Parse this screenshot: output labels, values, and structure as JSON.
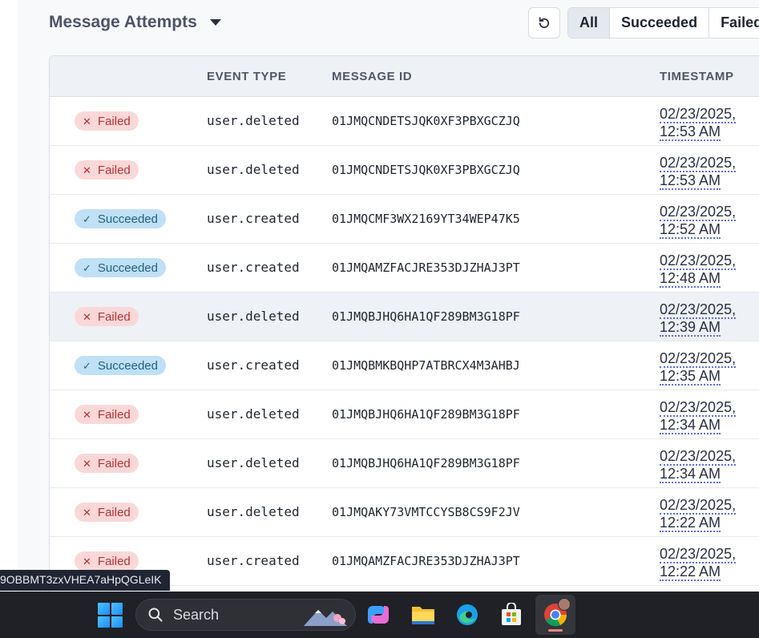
{
  "header": {
    "title": "Message Attempts",
    "filters": [
      "All",
      "Succeeded",
      "Failed"
    ],
    "active_filter": "All"
  },
  "table": {
    "columns": [
      "EVENT TYPE",
      "MESSAGE ID",
      "TIMESTAMP"
    ],
    "rows": [
      {
        "status": "Failed",
        "event": "user.deleted",
        "message_id": "01JMQCNDETSJQK0XF3PBXGCZJQ",
        "date": "02/23/2025,",
        "time": "12:53 AM"
      },
      {
        "status": "Failed",
        "event": "user.deleted",
        "message_id": "01JMQCNDETSJQK0XF3PBXGCZJQ",
        "date": "02/23/2025,",
        "time": "12:53 AM"
      },
      {
        "status": "Succeeded",
        "event": "user.created",
        "message_id": "01JMQCMF3WX2169YT34WEP47K5",
        "date": "02/23/2025,",
        "time": "12:52 AM"
      },
      {
        "status": "Succeeded",
        "event": "user.created",
        "message_id": "01JMQAMZFACJRE353DJZHAJ3PT",
        "date": "02/23/2025,",
        "time": "12:48 AM"
      },
      {
        "status": "Failed",
        "event": "user.deleted",
        "message_id": "01JMQBJHQ6HA1QF289BM3G18PF",
        "date": "02/23/2025,",
        "time": "12:39 AM"
      },
      {
        "status": "Succeeded",
        "event": "user.created",
        "message_id": "01JMQBMKBQHP7ATBRCX4M3AHBJ",
        "date": "02/23/2025,",
        "time": "12:35 AM"
      },
      {
        "status": "Failed",
        "event": "user.deleted",
        "message_id": "01JMQBJHQ6HA1QF289BM3G18PF",
        "date": "02/23/2025,",
        "time": "12:34 AM"
      },
      {
        "status": "Failed",
        "event": "user.deleted",
        "message_id": "01JMQBJHQ6HA1QF289BM3G18PF",
        "date": "02/23/2025,",
        "time": "12:34 AM"
      },
      {
        "status": "Failed",
        "event": "user.deleted",
        "message_id": "01JMQAKY73VMTCCYSB8CS9F2JV",
        "date": "02/23/2025,",
        "time": "12:22 AM"
      },
      {
        "status": "Failed",
        "event": "user.created",
        "message_id": "01JMQAMZFACJRE353DJZHAJ3PT",
        "date": "02/23/2025,",
        "time": "12:22 AM"
      }
    ]
  },
  "tooltip": {
    "text": "9OBBMT3zxVHEA7aHpQGLeIK"
  },
  "taskbar": {
    "search_label": "Search",
    "apps": [
      "copilot-icon",
      "file-explorer-icon",
      "edge-icon",
      "microsoft-store-icon",
      "chrome-icon"
    ]
  },
  "colors": {
    "failed_bg": "#fbd8d8",
    "failed_text": "#b83232",
    "succeeded_bg": "#bfe0f5",
    "succeeded_text": "#1f5f86",
    "accent_underline": "#5b6ee8"
  }
}
